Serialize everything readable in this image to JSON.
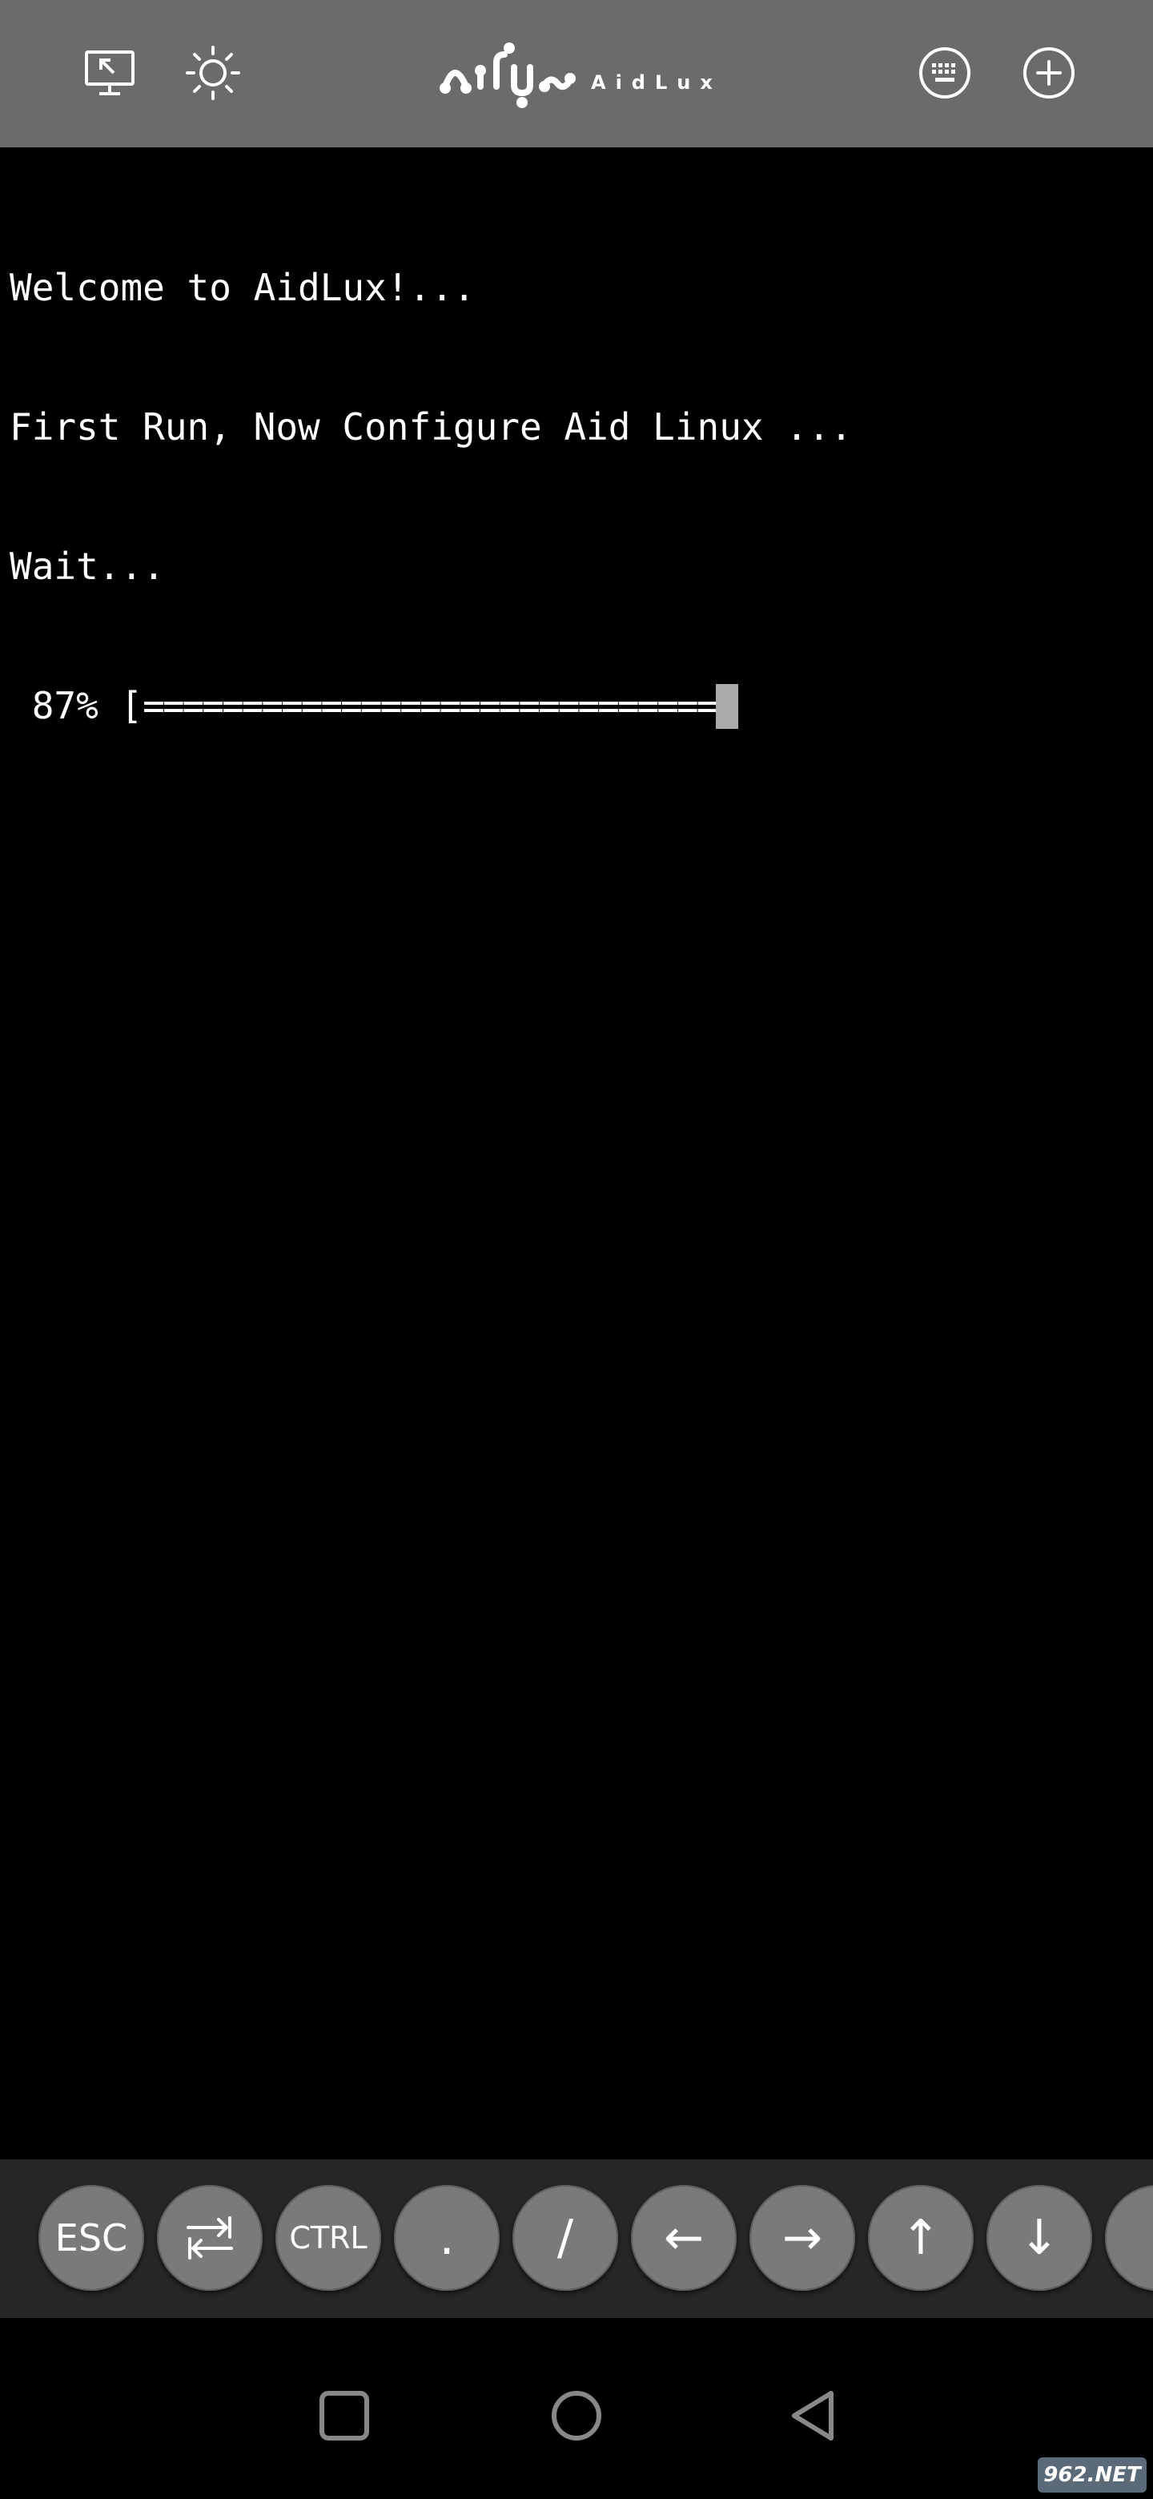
{
  "toolbar": {
    "icons": [
      "desktop-icon",
      "brightness-icon",
      "keyboard-icon",
      "add-icon"
    ],
    "logo_text": "AidLux"
  },
  "terminal": {
    "lines": [
      "Welcome to AidLux!...",
      "First Run, Now Configure Aid Linux ...",
      "Wait..."
    ],
    "progress": {
      "percent_label": " 87% [",
      "bar": "=============================",
      "value": 0.87
    }
  },
  "extra_keys": {
    "esc": "ESC",
    "tab_icon": "tab-swap-icon",
    "ctrl": "CTRL",
    "dot": ".",
    "slash": "/",
    "left": "←",
    "right": "→",
    "up": "↑",
    "down": "↓"
  },
  "navbar": {
    "icons": [
      "recent-apps-icon",
      "home-icon",
      "back-icon"
    ]
  },
  "watermark": {
    "text": "962.NET"
  },
  "colors": {
    "toolbar_bg": "#6b6b6b",
    "terminal_bg": "#000000",
    "terminal_fg": "#ffffff",
    "key_bg": "#7a7a7a",
    "keys_row_bg": "#262626",
    "cursor": "#aaaaaa"
  }
}
